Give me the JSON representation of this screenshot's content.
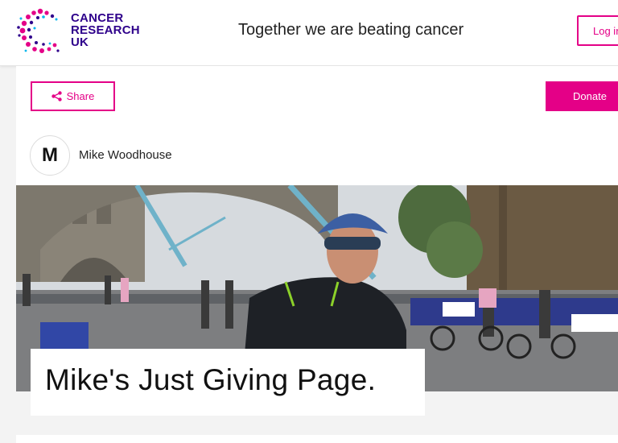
{
  "brand": {
    "lines": [
      "CANCER",
      "RESEARCH",
      "UK"
    ],
    "primary_color": "#2e008b",
    "accent_color": "#e40087"
  },
  "header": {
    "tagline": "Together we are beating cancer",
    "login_label": "Log in"
  },
  "actions": {
    "share_label": "Share",
    "share_icon": "share-icon",
    "donate_label": "Donate"
  },
  "owner": {
    "initial": "M",
    "name": "Mike Woodhouse"
  },
  "page": {
    "title": "Mike's Just Giving Page."
  }
}
